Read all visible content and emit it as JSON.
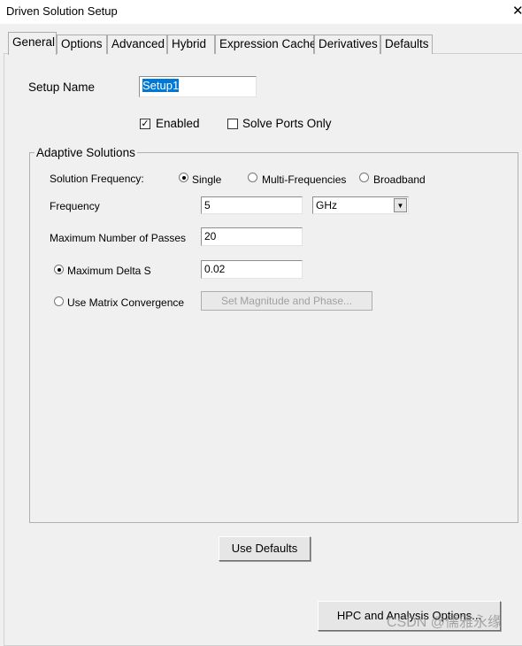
{
  "window": {
    "title": "Driven Solution Setup",
    "close_icon": "close-icon"
  },
  "tabs": [
    {
      "label": "General",
      "active": true
    },
    {
      "label": "Options"
    },
    {
      "label": "Advanced"
    },
    {
      "label": "Hybrid"
    },
    {
      "label": "Expression Cache"
    },
    {
      "label": "Derivatives"
    },
    {
      "label": "Defaults"
    }
  ],
  "general": {
    "setup_name_label": "Setup Name",
    "setup_name_value": "Setup1",
    "enabled_label": "Enabled",
    "enabled_checked": true,
    "solve_ports_label": "Solve Ports Only",
    "solve_ports_checked": false,
    "adaptive": {
      "group_label": "Adaptive Solutions",
      "solution_frequency_label": "Solution Frequency:",
      "freq_options": [
        "Single",
        "Multi-Frequencies",
        "Broadband"
      ],
      "freq_selected": "Single",
      "frequency_label": "Frequency",
      "frequency_value": "5",
      "frequency_unit": "GHz",
      "max_passes_label": "Maximum Number of Passes",
      "max_passes_value": "20",
      "max_delta_s_label": "Maximum Delta S",
      "max_delta_s_value": "0.02",
      "max_delta_s_selected": true,
      "matrix_conv_label": "Use Matrix Convergence",
      "matrix_conv_selected": false,
      "set_mag_phase_label": "Set Magnitude and Phase..."
    },
    "use_defaults_label": "Use Defaults",
    "hpc_label": "HPC and Analysis Options..."
  },
  "watermark": "CSDN @儒雅永缘"
}
